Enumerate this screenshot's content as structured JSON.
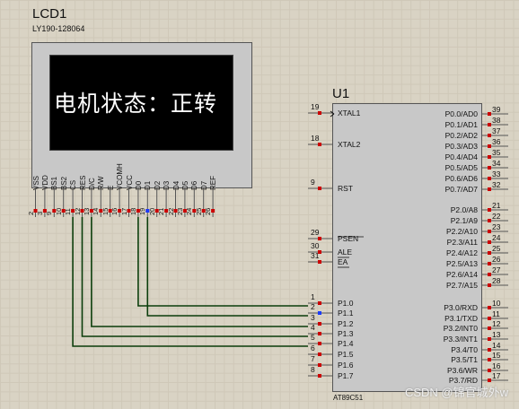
{
  "lcd": {
    "name": "LCD1",
    "part": "LY190-128064",
    "display_text": "电机状态：正转",
    "pins": [
      {
        "label": "VSS",
        "num": "2"
      },
      {
        "label": "VDD",
        "num": "3"
      },
      {
        "label": "BS1",
        "num": "9"
      },
      {
        "label": "BS2",
        "num": "10"
      },
      {
        "label": "CS",
        "num": "11"
      },
      {
        "label": "RES",
        "num": "12"
      },
      {
        "label": "D/C",
        "num": "13"
      },
      {
        "label": "R/W",
        "num": "14"
      },
      {
        "label": "E",
        "num": "15"
      },
      {
        "label": "VCOMH",
        "num": "16"
      },
      {
        "label": "VCC",
        "num": "17"
      },
      {
        "label": "D0",
        "num": "18"
      },
      {
        "label": "D1",
        "num": "19"
      },
      {
        "label": "D2",
        "num": "20"
      },
      {
        "label": "D3",
        "num": "21"
      },
      {
        "label": "D4",
        "num": "22"
      },
      {
        "label": "D5",
        "num": "23"
      },
      {
        "label": "D6",
        "num": "24"
      },
      {
        "label": "D7",
        "num": "25"
      },
      {
        "label": "REF",
        "num": "26"
      }
    ]
  },
  "mcu": {
    "name": "U1",
    "part": "AT89C51",
    "left_pins": [
      {
        "label": "XTAL1",
        "num": "19"
      },
      {
        "label": "XTAL2",
        "num": "18"
      },
      {
        "label": "RST",
        "num": "9"
      },
      {
        "label": "PSEN",
        "num": "29"
      },
      {
        "label": "ALE",
        "num": "30"
      },
      {
        "label": "EA",
        "num": "31"
      },
      {
        "label": "P1.0",
        "num": "1"
      },
      {
        "label": "P1.1",
        "num": "2"
      },
      {
        "label": "P1.2",
        "num": "3"
      },
      {
        "label": "P1.3",
        "num": "4"
      },
      {
        "label": "P1.4",
        "num": "5"
      },
      {
        "label": "P1.5",
        "num": "6"
      },
      {
        "label": "P1.6",
        "num": "7"
      },
      {
        "label": "P1.7",
        "num": "8"
      }
    ],
    "right_pins": [
      {
        "label": "P0.0/AD0",
        "num": "39"
      },
      {
        "label": "P0.1/AD1",
        "num": "38"
      },
      {
        "label": "P0.2/AD2",
        "num": "37"
      },
      {
        "label": "P0.3/AD3",
        "num": "36"
      },
      {
        "label": "P0.4/AD4",
        "num": "35"
      },
      {
        "label": "P0.5/AD5",
        "num": "34"
      },
      {
        "label": "P0.6/AD6",
        "num": "33"
      },
      {
        "label": "P0.7/AD7",
        "num": "32"
      },
      {
        "label": "P2.0/A8",
        "num": "21"
      },
      {
        "label": "P2.1/A9",
        "num": "22"
      },
      {
        "label": "P2.2/A10",
        "num": "23"
      },
      {
        "label": "P2.3/A11",
        "num": "24"
      },
      {
        "label": "P2.4/A12",
        "num": "25"
      },
      {
        "label": "P2.5/A13",
        "num": "26"
      },
      {
        "label": "P2.6/A14",
        "num": "27"
      },
      {
        "label": "P2.7/A15",
        "num": "28"
      },
      {
        "label": "P3.0/RXD",
        "num": "10"
      },
      {
        "label": "P3.1/TXD",
        "num": "11"
      },
      {
        "label": "P3.2/INT0",
        "num": "12"
      },
      {
        "label": "P3.3/INT1",
        "num": "13"
      },
      {
        "label": "P3.4/T0",
        "num": "14"
      },
      {
        "label": "P3.5/T1",
        "num": "15"
      },
      {
        "label": "P3.6/WR",
        "num": "16"
      },
      {
        "label": "P3.7/RD",
        "num": "17"
      }
    ]
  },
  "watermark": "CSDN @锦官城外w",
  "colors": {
    "wire": "#0b3d0b",
    "pin_red": "#cc0000",
    "pin_blue": "#1a3cff",
    "canvas": "#d9d3c4"
  }
}
